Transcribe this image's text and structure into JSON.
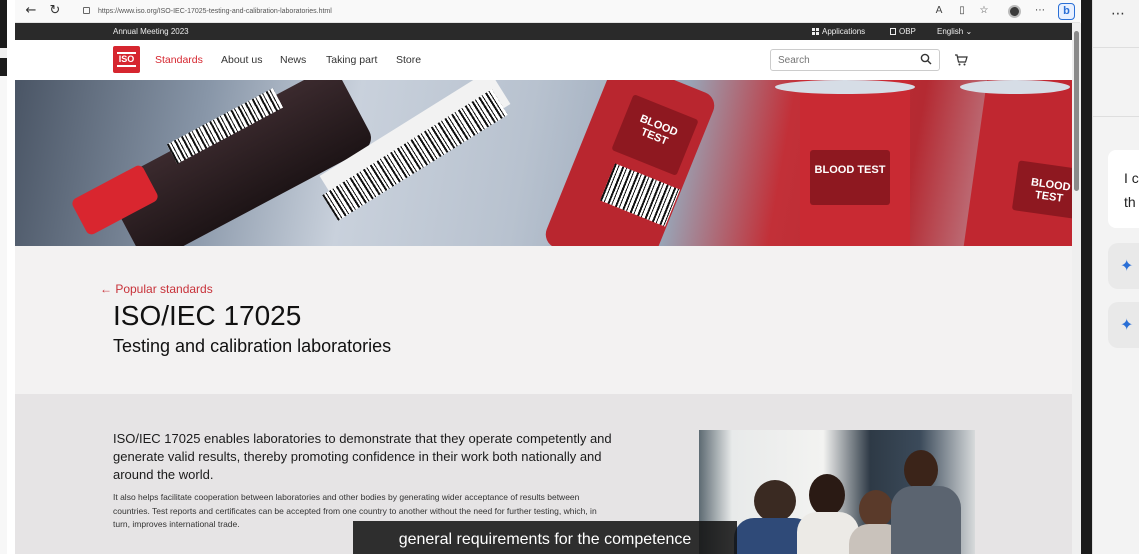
{
  "browser": {
    "url": "https://www.iso.org/ISO-IEC-17025-testing-and-calibration-laboratories.html",
    "back_icon": "←",
    "refresh_icon": "↻",
    "bing_label": "b"
  },
  "site": {
    "topbar": {
      "meeting": "Annual Meeting 2023",
      "applications": "Applications",
      "obp": "OBP",
      "language": "English ⌄"
    },
    "logo_text": "ISO",
    "nav": [
      "Standards",
      "About us",
      "News",
      "Taking part",
      "Store"
    ],
    "search_placeholder": "Search",
    "hero": {
      "tube_label_1": "BLOOD TEST",
      "tube_label_2": "BLOOD TEST",
      "tube_label_3": "BLOOD TEST"
    },
    "back_link": "← Popular standards",
    "title": "ISO/IEC 17025",
    "subtitle": "Testing and calibration laboratories",
    "lead": "ISO/IEC 17025 enables laboratories to demonstrate that they operate competently and generate valid results, thereby promoting confidence in their work both nationally and around the world.",
    "body": "It also helps facilitate cooperation between laboratories and other bodies by generating wider acceptance of results between countries. Test reports and certificates can be accepted from one country to another without the need for further testing, which, in turn, improves international trade."
  },
  "sidebar": {
    "more": "⋯",
    "chat_text": "I c th",
    "spark": "✦"
  },
  "caption": "general requirements for the competence"
}
